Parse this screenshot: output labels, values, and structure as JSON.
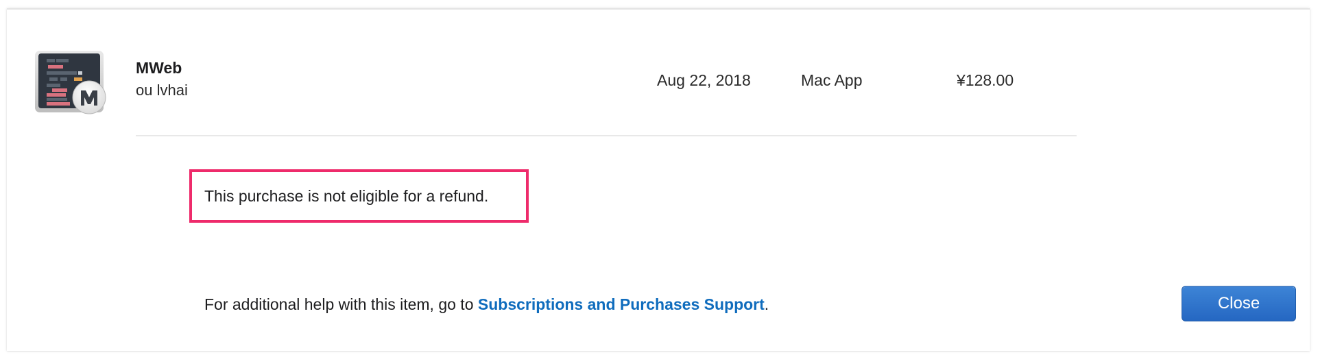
{
  "item": {
    "app_name": "MWeb",
    "developer": "ou lvhai",
    "purchase_date": "Aug 22, 2018",
    "type": "Mac App",
    "price": "¥128.00",
    "icon": "mweb-app-icon"
  },
  "refund": {
    "message": "This purchase is not eligible for a refund."
  },
  "help": {
    "prefix": "For additional help with this item, go to ",
    "link_label": "Subscriptions and Purchases Support",
    "suffix": "."
  },
  "actions": {
    "close_label": "Close"
  },
  "colors": {
    "link": "#0f6cbd",
    "button": "#2f74cc",
    "highlight_border": "#ee2b6b"
  }
}
